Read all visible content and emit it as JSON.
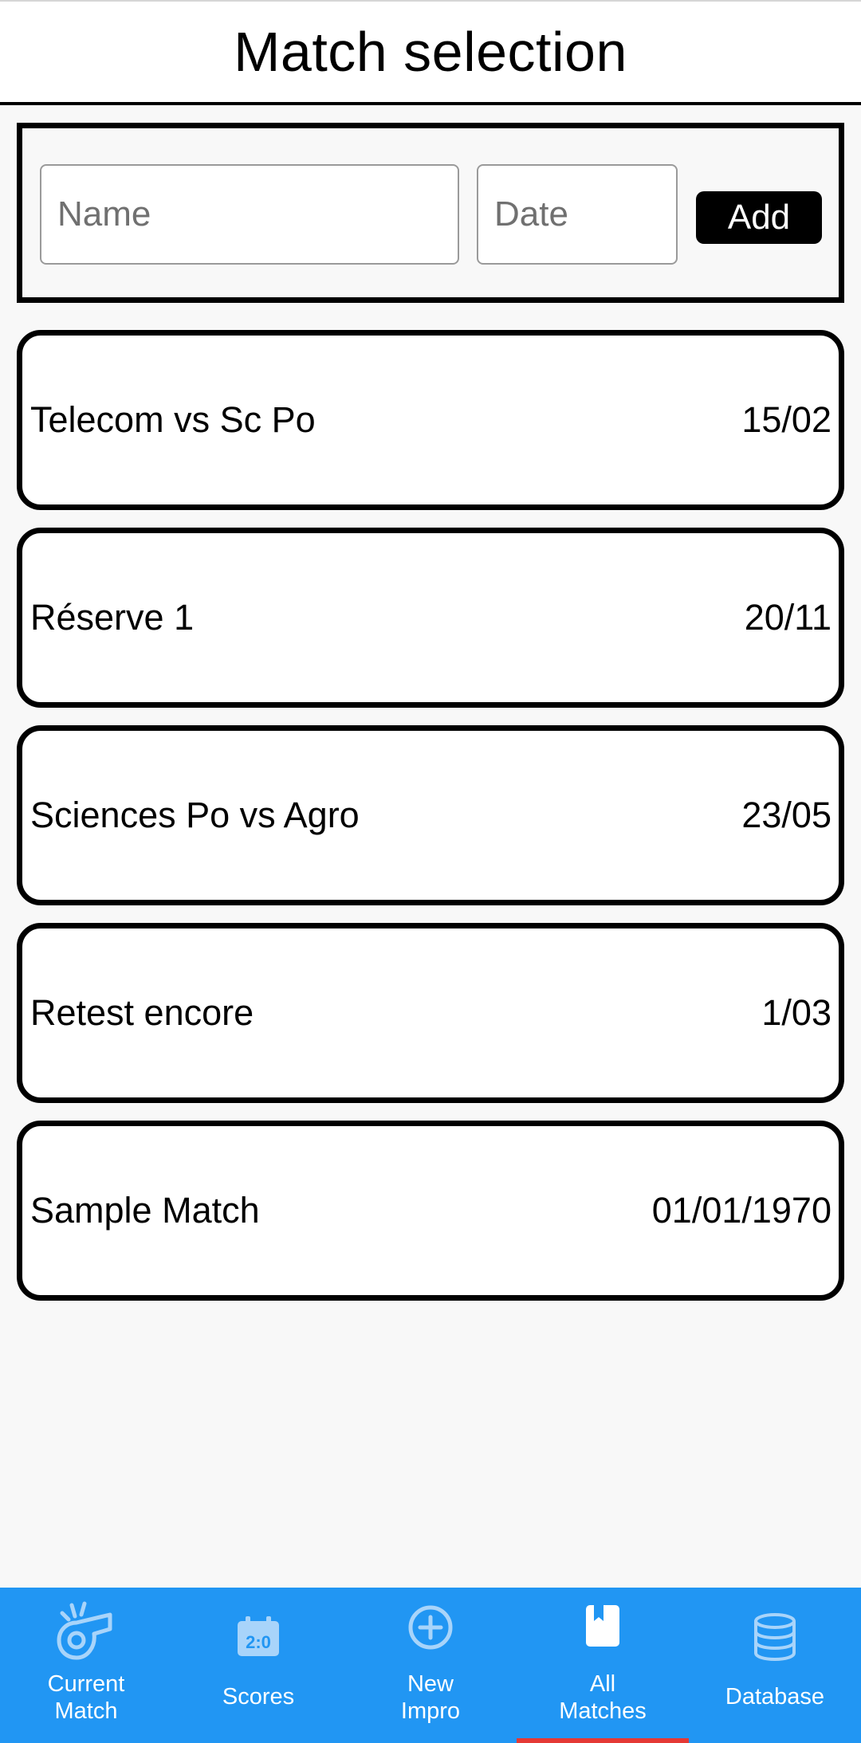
{
  "header": {
    "title": "Match selection"
  },
  "add_form": {
    "name_placeholder": "Name",
    "date_placeholder": "Date",
    "add_label": "Add"
  },
  "matches": [
    {
      "name": "Telecom vs Sc Po",
      "date": "15/02"
    },
    {
      "name": "Réserve 1",
      "date": "20/11"
    },
    {
      "name": "Sciences Po vs Agro",
      "date": "23/05"
    },
    {
      "name": "Retest encore",
      "date": "1/03"
    },
    {
      "name": "Sample Match",
      "date": "01/01/1970"
    }
  ],
  "bottom_nav": {
    "items": [
      {
        "label_line1": "Current",
        "label_line2": "Match",
        "icon": "whistle-icon"
      },
      {
        "label": "Scores",
        "icon": "scoreboard-icon"
      },
      {
        "label_line1": "New",
        "label_line2": "Impro",
        "icon": "add-circle-icon"
      },
      {
        "label_line1": "All",
        "label_line2": "Matches",
        "icon": "bookmark-book-icon",
        "active": true
      },
      {
        "label": "Database",
        "icon": "database-icon"
      }
    ],
    "active_index": 3
  },
  "colors": {
    "nav_background": "#2196f3",
    "nav_icon_inactive": "#a8d4fa",
    "active_indicator": "#e53935",
    "page_background": "#f8f8f8"
  }
}
